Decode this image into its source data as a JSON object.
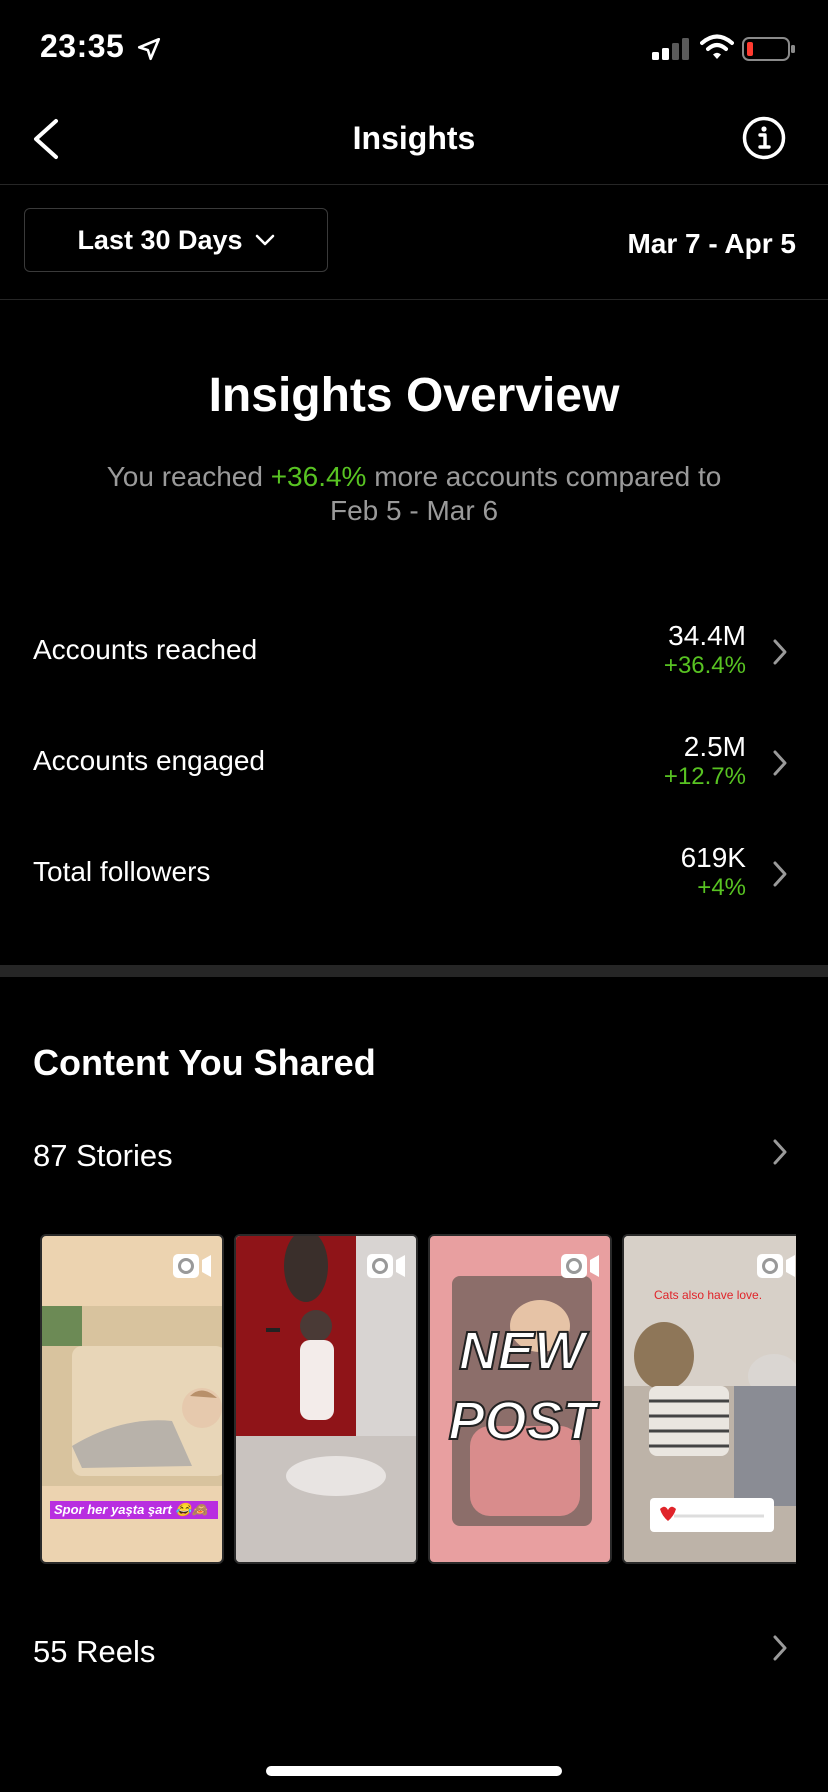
{
  "status_bar": {
    "time": "23:35"
  },
  "nav": {
    "title": "Insights"
  },
  "filter": {
    "range_label": "Last 30 Days",
    "date_range": "Mar 7 - Apr 5"
  },
  "overview": {
    "title": "Insights Overview",
    "subtitle_prefix": "You reached",
    "subtitle_delta": "+36.4%",
    "subtitle_suffix": "more accounts compared to",
    "compare_range": "Feb 5 - Mar 6"
  },
  "metrics": [
    {
      "label": "Accounts reached",
      "value": "34.4M",
      "delta": "+36.4%"
    },
    {
      "label": "Accounts engaged",
      "value": "2.5M",
      "delta": "+12.7%"
    },
    {
      "label": "Total followers",
      "value": "619K",
      "delta": "+4%"
    }
  ],
  "content": {
    "title": "Content You Shared",
    "stories_label": "87 Stories",
    "reels_label": "55 Reels",
    "thumbnails": [
      {
        "caption": "Spor her yaşta şart 😂🙈"
      },
      {
        "caption": ""
      },
      {
        "caption": "NEW POST"
      },
      {
        "caption": "Cats also have love."
      }
    ]
  },
  "colors": {
    "positive": "#58c322",
    "background": "#000000",
    "divider": "#262626"
  }
}
